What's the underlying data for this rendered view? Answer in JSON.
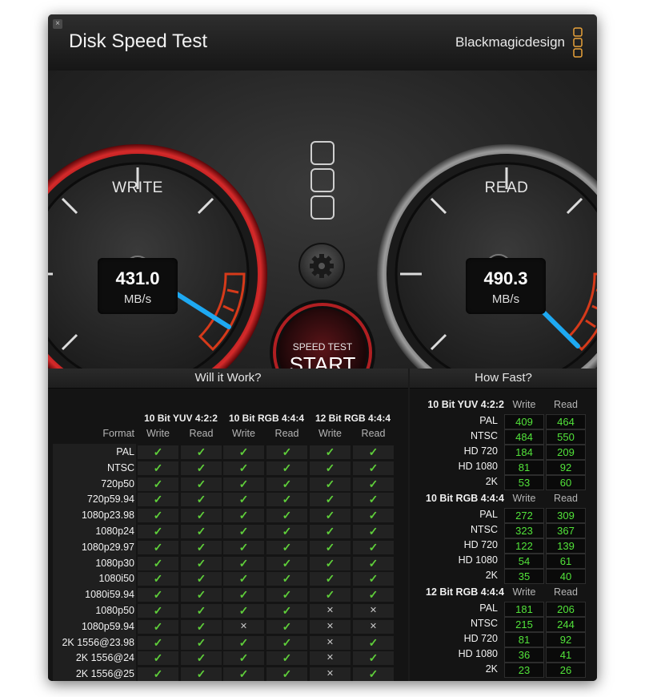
{
  "window": {
    "title": "Disk Speed Test",
    "brand": "Blackmagicdesign",
    "close_label": "×"
  },
  "gauges": {
    "write": {
      "label": "WRITE",
      "value": "431.0",
      "unit": "MB/s"
    },
    "read": {
      "label": "READ",
      "value": "490.3",
      "unit": "MB/s"
    }
  },
  "start_button": {
    "small": "SPEED TEST",
    "big": "START"
  },
  "colors": {
    "needle": "#1ea9f2",
    "ok": "#5fcf3a",
    "value_green": "#52e33a",
    "accent_red": "#c4161c"
  },
  "will_it_work": {
    "title": "Will it Work?",
    "format_label": "Format",
    "groups": [
      "10 Bit YUV 4:2:2",
      "10 Bit RGB 4:4:4",
      "12 Bit RGB 4:4:4"
    ],
    "sub_labels": [
      "Write",
      "Read"
    ],
    "rows": [
      {
        "format": "PAL",
        "cells": [
          1,
          1,
          1,
          1,
          1,
          1
        ]
      },
      {
        "format": "NTSC",
        "cells": [
          1,
          1,
          1,
          1,
          1,
          1
        ]
      },
      {
        "format": "720p50",
        "cells": [
          1,
          1,
          1,
          1,
          1,
          1
        ]
      },
      {
        "format": "720p59.94",
        "cells": [
          1,
          1,
          1,
          1,
          1,
          1
        ]
      },
      {
        "format": "1080p23.98",
        "cells": [
          1,
          1,
          1,
          1,
          1,
          1
        ]
      },
      {
        "format": "1080p24",
        "cells": [
          1,
          1,
          1,
          1,
          1,
          1
        ]
      },
      {
        "format": "1080p29.97",
        "cells": [
          1,
          1,
          1,
          1,
          1,
          1
        ]
      },
      {
        "format": "1080p30",
        "cells": [
          1,
          1,
          1,
          1,
          1,
          1
        ]
      },
      {
        "format": "1080i50",
        "cells": [
          1,
          1,
          1,
          1,
          1,
          1
        ]
      },
      {
        "format": "1080i59.94",
        "cells": [
          1,
          1,
          1,
          1,
          1,
          1
        ]
      },
      {
        "format": "1080p50",
        "cells": [
          1,
          1,
          1,
          1,
          0,
          0
        ]
      },
      {
        "format": "1080p59.94",
        "cells": [
          1,
          1,
          0,
          1,
          0,
          0
        ]
      },
      {
        "format": "2K 1556@23.98",
        "cells": [
          1,
          1,
          1,
          1,
          0,
          1
        ]
      },
      {
        "format": "2K 1556@24",
        "cells": [
          1,
          1,
          1,
          1,
          0,
          1
        ]
      },
      {
        "format": "2K 1556@25",
        "cells": [
          1,
          1,
          1,
          1,
          0,
          1
        ]
      }
    ]
  },
  "how_fast": {
    "title": "How Fast?",
    "sub_labels": [
      "Write",
      "Read"
    ],
    "groups": [
      {
        "name": "10 Bit YUV 4:2:2",
        "rows": [
          {
            "label": "PAL",
            "write": "409",
            "read": "464"
          },
          {
            "label": "NTSC",
            "write": "484",
            "read": "550"
          },
          {
            "label": "HD 720",
            "write": "184",
            "read": "209"
          },
          {
            "label": "HD 1080",
            "write": "81",
            "read": "92"
          },
          {
            "label": "2K",
            "write": "53",
            "read": "60"
          }
        ]
      },
      {
        "name": "10 Bit RGB 4:4:4",
        "rows": [
          {
            "label": "PAL",
            "write": "272",
            "read": "309"
          },
          {
            "label": "NTSC",
            "write": "323",
            "read": "367"
          },
          {
            "label": "HD 720",
            "write": "122",
            "read": "139"
          },
          {
            "label": "HD 1080",
            "write": "54",
            "read": "61"
          },
          {
            "label": "2K",
            "write": "35",
            "read": "40"
          }
        ]
      },
      {
        "name": "12 Bit RGB 4:4:4",
        "rows": [
          {
            "label": "PAL",
            "write": "181",
            "read": "206"
          },
          {
            "label": "NTSC",
            "write": "215",
            "read": "244"
          },
          {
            "label": "HD 720",
            "write": "81",
            "read": "92"
          },
          {
            "label": "HD 1080",
            "write": "36",
            "read": "41"
          },
          {
            "label": "2K",
            "write": "23",
            "read": "26"
          }
        ]
      }
    ]
  }
}
